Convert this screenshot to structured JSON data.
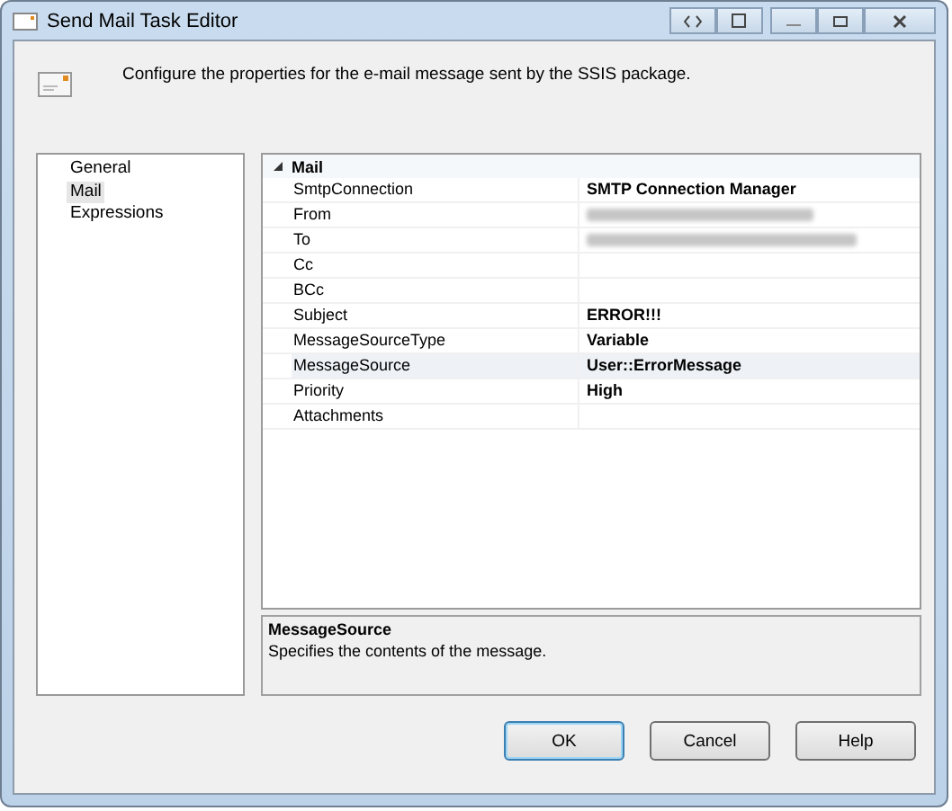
{
  "window": {
    "title": "Send Mail Task Editor"
  },
  "header": {
    "text": "Configure the properties for the e-mail message sent by the SSIS package."
  },
  "sidebar": {
    "items": [
      {
        "label": "General",
        "selected": false
      },
      {
        "label": "Mail",
        "selected": true
      },
      {
        "label": "Expressions",
        "selected": false
      }
    ]
  },
  "property_grid": {
    "category": {
      "label": "Mail",
      "expanded": true
    },
    "rows": [
      {
        "name": "SmtpConnection",
        "kind": "text",
        "value": "SMTP Connection Manager",
        "selected": false
      },
      {
        "name": "From",
        "kind": "blurred",
        "selected": false
      },
      {
        "name": "To",
        "kind": "blurred",
        "selected": false
      },
      {
        "name": "Cc",
        "kind": "empty",
        "selected": false
      },
      {
        "name": "BCc",
        "kind": "empty",
        "selected": false
      },
      {
        "name": "Subject",
        "kind": "text",
        "value": "ERROR!!!",
        "selected": false
      },
      {
        "name": "MessageSourceType",
        "kind": "text",
        "value": "Variable",
        "selected": false
      },
      {
        "name": "MessageSource",
        "kind": "text",
        "value": "User::ErrorMessage",
        "selected": true
      },
      {
        "name": "Priority",
        "kind": "text",
        "value": "High",
        "selected": false
      },
      {
        "name": "Attachments",
        "kind": "empty",
        "selected": false
      }
    ]
  },
  "description": {
    "title": "MessageSource",
    "text": "Specifies the contents of the message."
  },
  "buttons": [
    {
      "label": "OK",
      "default": true
    },
    {
      "label": "Cancel",
      "default": false
    },
    {
      "label": "Help",
      "default": false
    }
  ]
}
